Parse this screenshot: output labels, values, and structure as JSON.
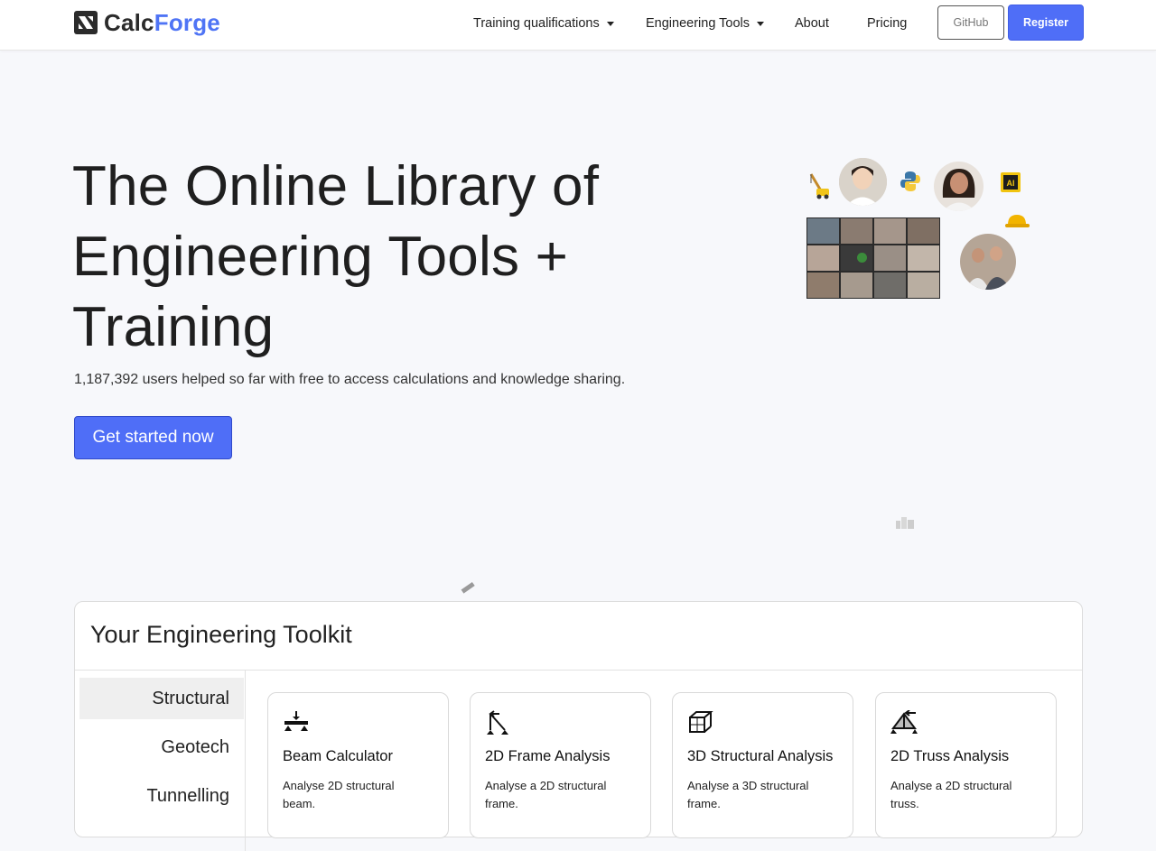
{
  "brand": {
    "name_part1": "Calc",
    "name_part2": "Forge"
  },
  "nav": {
    "items": [
      {
        "label": "Training qualifications",
        "dropdown": true
      },
      {
        "label": "Engineering Tools",
        "dropdown": true
      },
      {
        "label": "About",
        "dropdown": false
      },
      {
        "label": "Pricing",
        "dropdown": false
      }
    ],
    "github_label": "GitHub",
    "register_label": "Register"
  },
  "hero": {
    "title_line1": "The Online Library of",
    "title_line2": "Engineering Tools +",
    "title_line3": "Training",
    "subtitle": "1,187,392 users helped so far with free to access calculations and knowledge sharing.",
    "cta_label": "Get started now"
  },
  "collage": {
    "badge_ai": "AI",
    "icons": [
      "crane-icon",
      "python-icon",
      "ai-chip-icon",
      "hard-hat-icon",
      "city-buildings-icon",
      "ruler-icon"
    ]
  },
  "toolkit": {
    "title": "Your Engineering Toolkit",
    "categories": [
      {
        "label": "Structural",
        "active": true
      },
      {
        "label": "Geotech",
        "active": false
      },
      {
        "label": "Tunnelling",
        "active": false
      }
    ],
    "tools": [
      {
        "name": "Beam Calculator",
        "description": "Analyse 2D structural beam.",
        "icon": "beam-icon"
      },
      {
        "name": "2D Frame Analysis",
        "description": "Analyse a 2D structural frame.",
        "icon": "frame-icon"
      },
      {
        "name": "3D Structural Analysis",
        "description": "Analyse a 3D structural frame.",
        "icon": "cube-frame-icon"
      },
      {
        "name": "2D Truss Analysis",
        "description": "Analyse a 2D structural truss.",
        "icon": "truss-icon"
      }
    ]
  },
  "colors": {
    "accent": "#4f6ef7",
    "brand_blue": "#4f74f5",
    "page_bg": "#f7f8fb"
  }
}
